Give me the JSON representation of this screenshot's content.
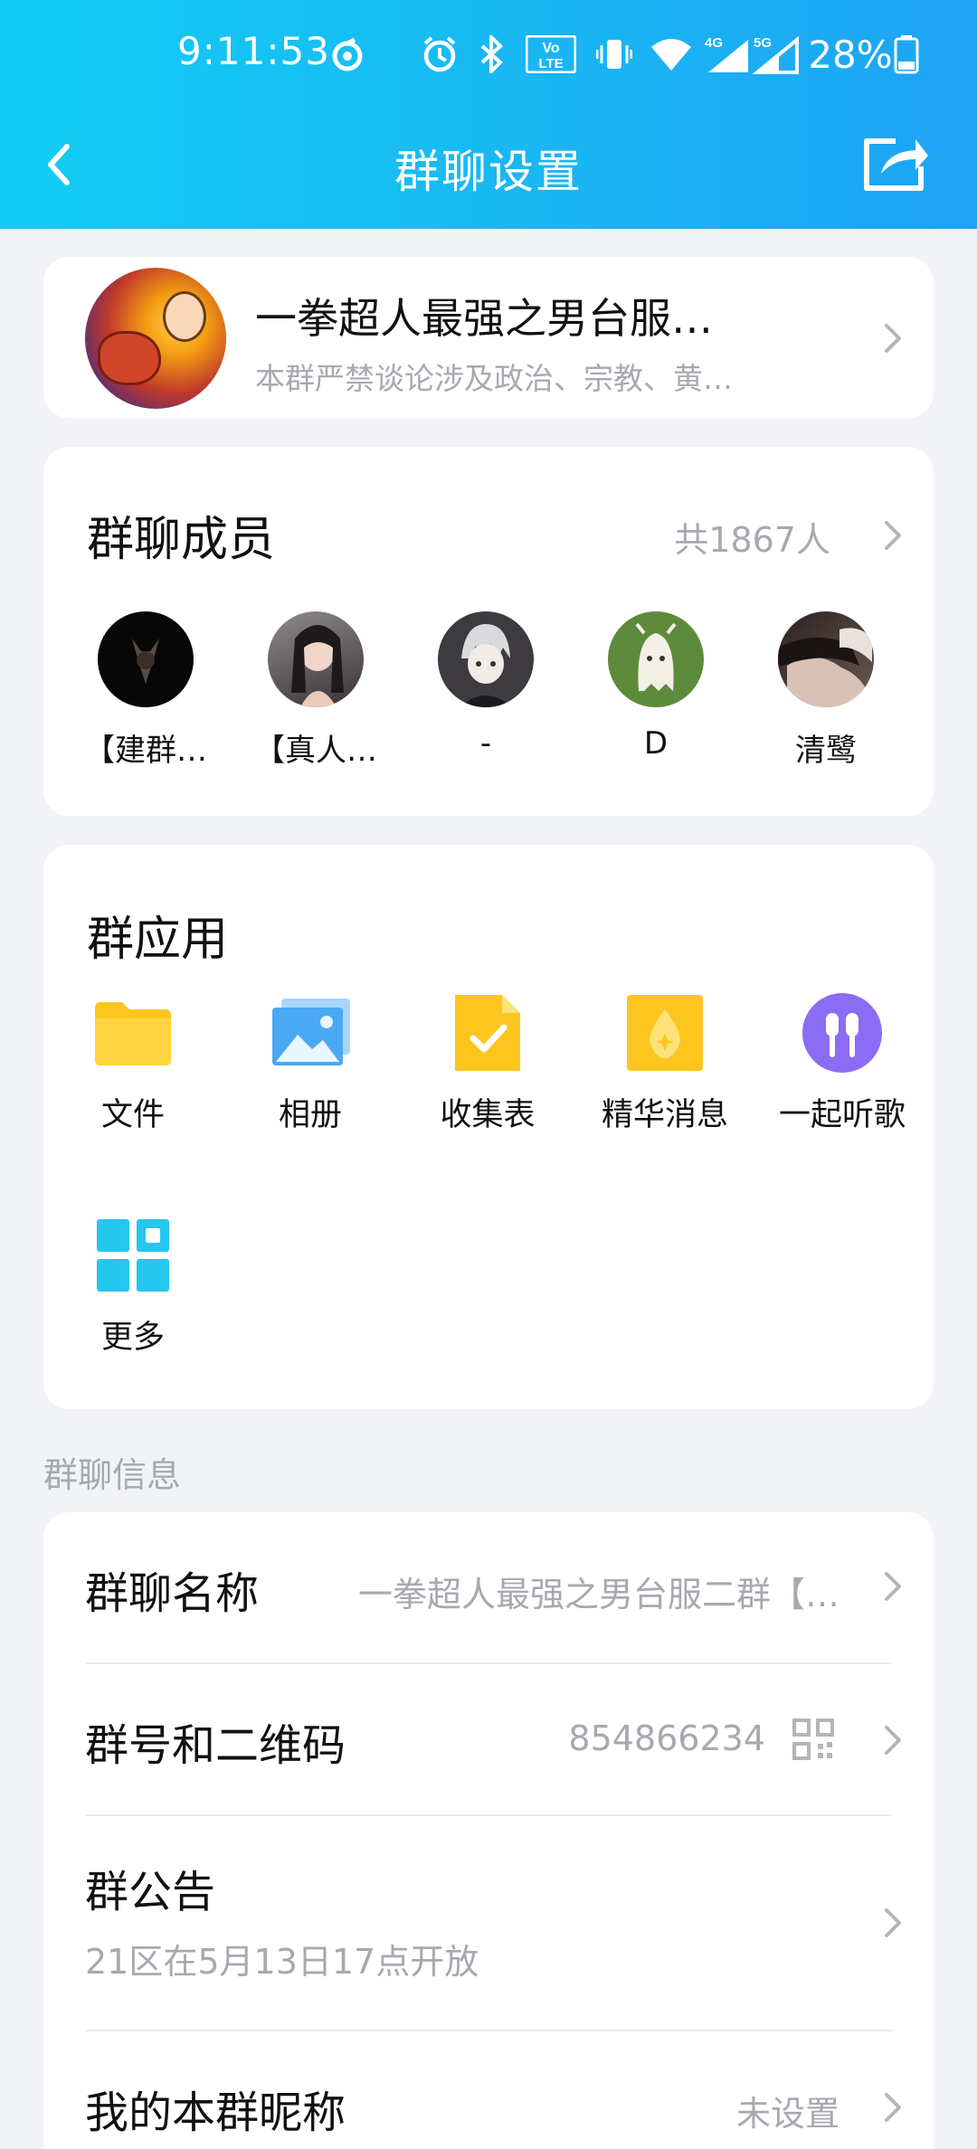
{
  "status_bar": {
    "time": "9:11:53",
    "battery": "28%",
    "icons": [
      "sync-icon",
      "alarm-icon",
      "bluetooth-icon",
      "volte-icon",
      "vibrate-icon",
      "wifi-icon",
      "signal-4g-icon",
      "signal-5g-icon",
      "battery-icon"
    ],
    "net_4g": "4G",
    "net_5g": "5G",
    "volte_top": "Vo",
    "volte_bottom": "LTE"
  },
  "nav": {
    "title": "群聊设置"
  },
  "group": {
    "name": "一拳超人最强之男台服…",
    "description": "本群严禁谈论涉及政治、宗教、黄…"
  },
  "members": {
    "title": "群聊成员",
    "count": "共1867人",
    "list": [
      {
        "name": "【建群…"
      },
      {
        "name": "【真人…"
      },
      {
        "name": "-"
      },
      {
        "name": "D"
      },
      {
        "name": "清鹭"
      }
    ]
  },
  "apps": {
    "title": "群应用",
    "items": [
      {
        "label": "文件",
        "icon": "folder-icon",
        "color": "#ffc51f"
      },
      {
        "label": "相册",
        "icon": "photo-album-icon",
        "color": "#4aa8f5"
      },
      {
        "label": "收集表",
        "icon": "form-collect-icon",
        "color": "#ffc51f"
      },
      {
        "label": "精华消息",
        "icon": "essence-message-icon",
        "color": "#ffc51f"
      },
      {
        "label": "一起听歌",
        "icon": "listen-together-icon",
        "color": "#8b6cf4"
      },
      {
        "label": "更多",
        "icon": "more-apps-icon",
        "color": "#25c7ee"
      }
    ]
  },
  "info": {
    "section_label": "群聊信息",
    "rows": [
      {
        "title": "群聊名称",
        "value": "一拳超人最强之男台服二群【…"
      },
      {
        "title": "群号和二维码",
        "value": "854866234"
      },
      {
        "title": "群公告",
        "value": "21区在5月13日17点开放"
      },
      {
        "title": "我的本群昵称",
        "value": "未设置"
      }
    ]
  },
  "colors": {
    "header_start": "#12cdf3",
    "header_end": "#1ea3f5",
    "background": "#f2f3f7",
    "secondary_text": "#a7a9b0"
  }
}
